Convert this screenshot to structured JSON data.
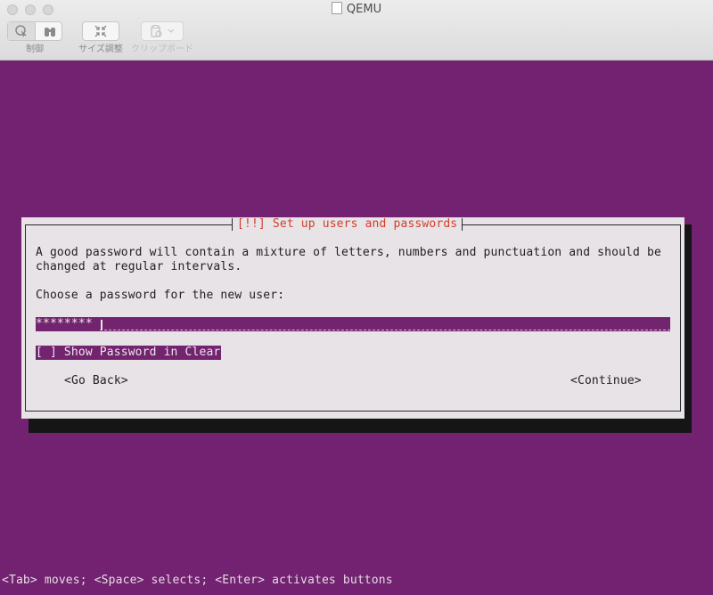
{
  "window": {
    "title": "QEMU",
    "toolbar": {
      "control_label": "制御",
      "resize_label": "サイズ調整",
      "clipboard_label": "クリップボード"
    }
  },
  "installer": {
    "dialog_title": "[!!] Set up users and passwords",
    "description_line1": "A good password will contain a mixture of letters, numbers and punctuation and should be",
    "description_line2": "changed at regular intervals.",
    "prompt": "Choose a password for the new user:",
    "password_value": "********",
    "show_password_label": "[ ] Show Password in Clear",
    "go_back_label": "<Go Back>",
    "continue_label": "<Continue>",
    "status_line": "<Tab> moves; <Space> selects; <Enter> activates buttons"
  },
  "colors": {
    "background": "#722270",
    "dialog_bg": "#e7e3e6",
    "title_red": "#d43d2c"
  }
}
